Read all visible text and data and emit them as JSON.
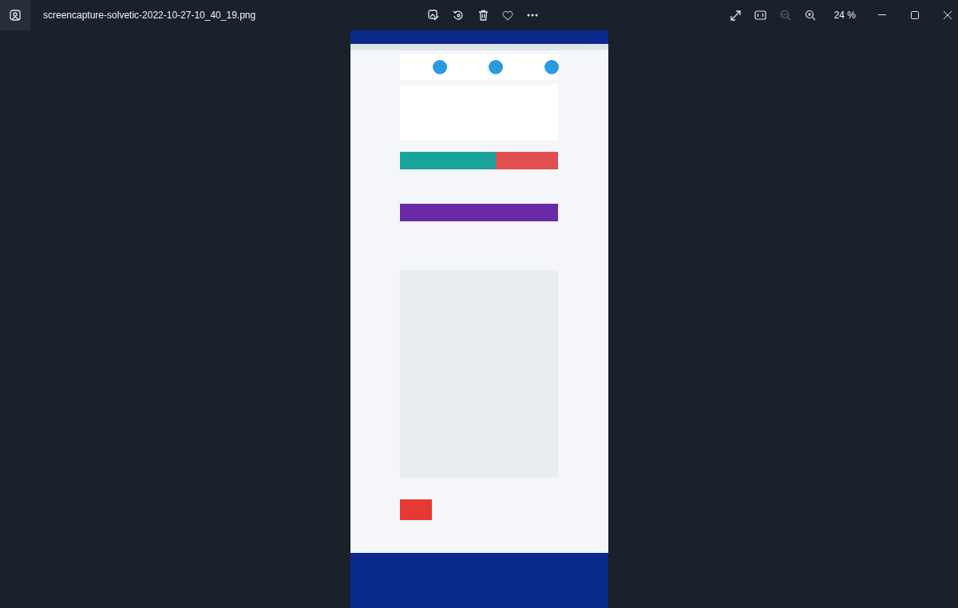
{
  "window": {
    "title": "screencapture-solvetic-2022-10-27-10_40_19.png"
  },
  "zoom_level": "24 %"
}
